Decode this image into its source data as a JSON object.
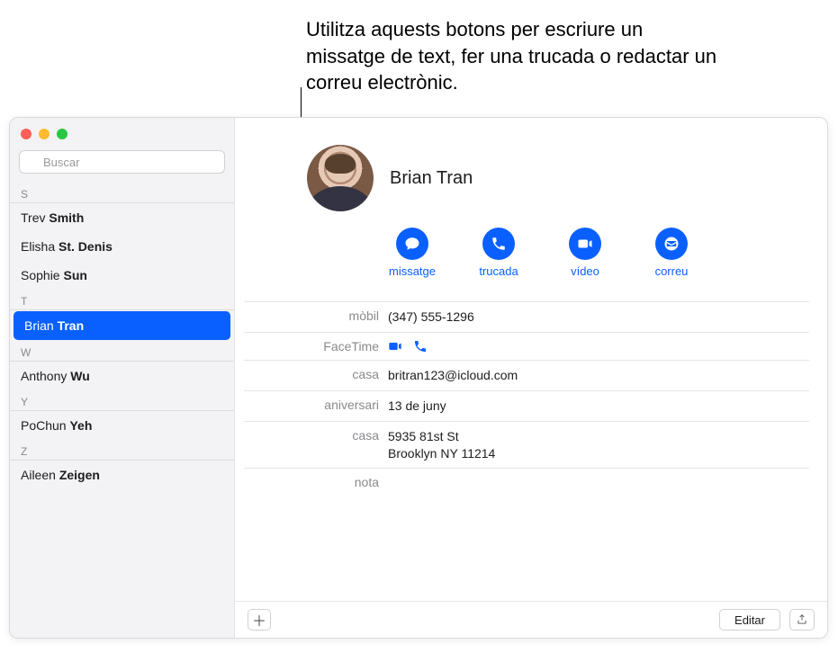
{
  "callout": {
    "text": "Utilitza aquests botons per escriure un missatge de text, fer una trucada o redactar un correu electrònic."
  },
  "search": {
    "placeholder": "Buscar"
  },
  "sections": [
    {
      "letter": "S",
      "rows": [
        {
          "first": "Trev",
          "last": "Smith"
        },
        {
          "first": "Elisha",
          "last": "St. Denis"
        },
        {
          "first": "Sophie",
          "last": "Sun"
        }
      ]
    },
    {
      "letter": "T",
      "rows": [
        {
          "first": "Brian",
          "last": "Tran",
          "selected": true
        }
      ]
    },
    {
      "letter": "W",
      "rows": [
        {
          "first": "Anthony",
          "last": "Wu"
        }
      ]
    },
    {
      "letter": "Y",
      "rows": [
        {
          "first": "PoChun",
          "last": "Yeh"
        }
      ]
    },
    {
      "letter": "Z",
      "rows": [
        {
          "first": "Aileen",
          "last": "Zeigen"
        }
      ]
    }
  ],
  "contact": {
    "name": "Brian Tran",
    "actions": {
      "message": "missatge",
      "call": "trucada",
      "video": "vídeo",
      "mail": "correu"
    },
    "fields": {
      "mobile_label": "mòbil",
      "mobile_value": "(347) 555-1296",
      "facetime_label": "FaceTime",
      "home_email_label": "casa",
      "home_email_value": "britran123@icloud.com",
      "anniversary_label": "aniversari",
      "anniversary_value": "13 de juny",
      "home_addr_label": "casa",
      "home_addr_line1": "5935 81st St",
      "home_addr_line2": "Brooklyn NY 11214",
      "note_label": "nota"
    }
  },
  "footer": {
    "edit": "Editar"
  }
}
